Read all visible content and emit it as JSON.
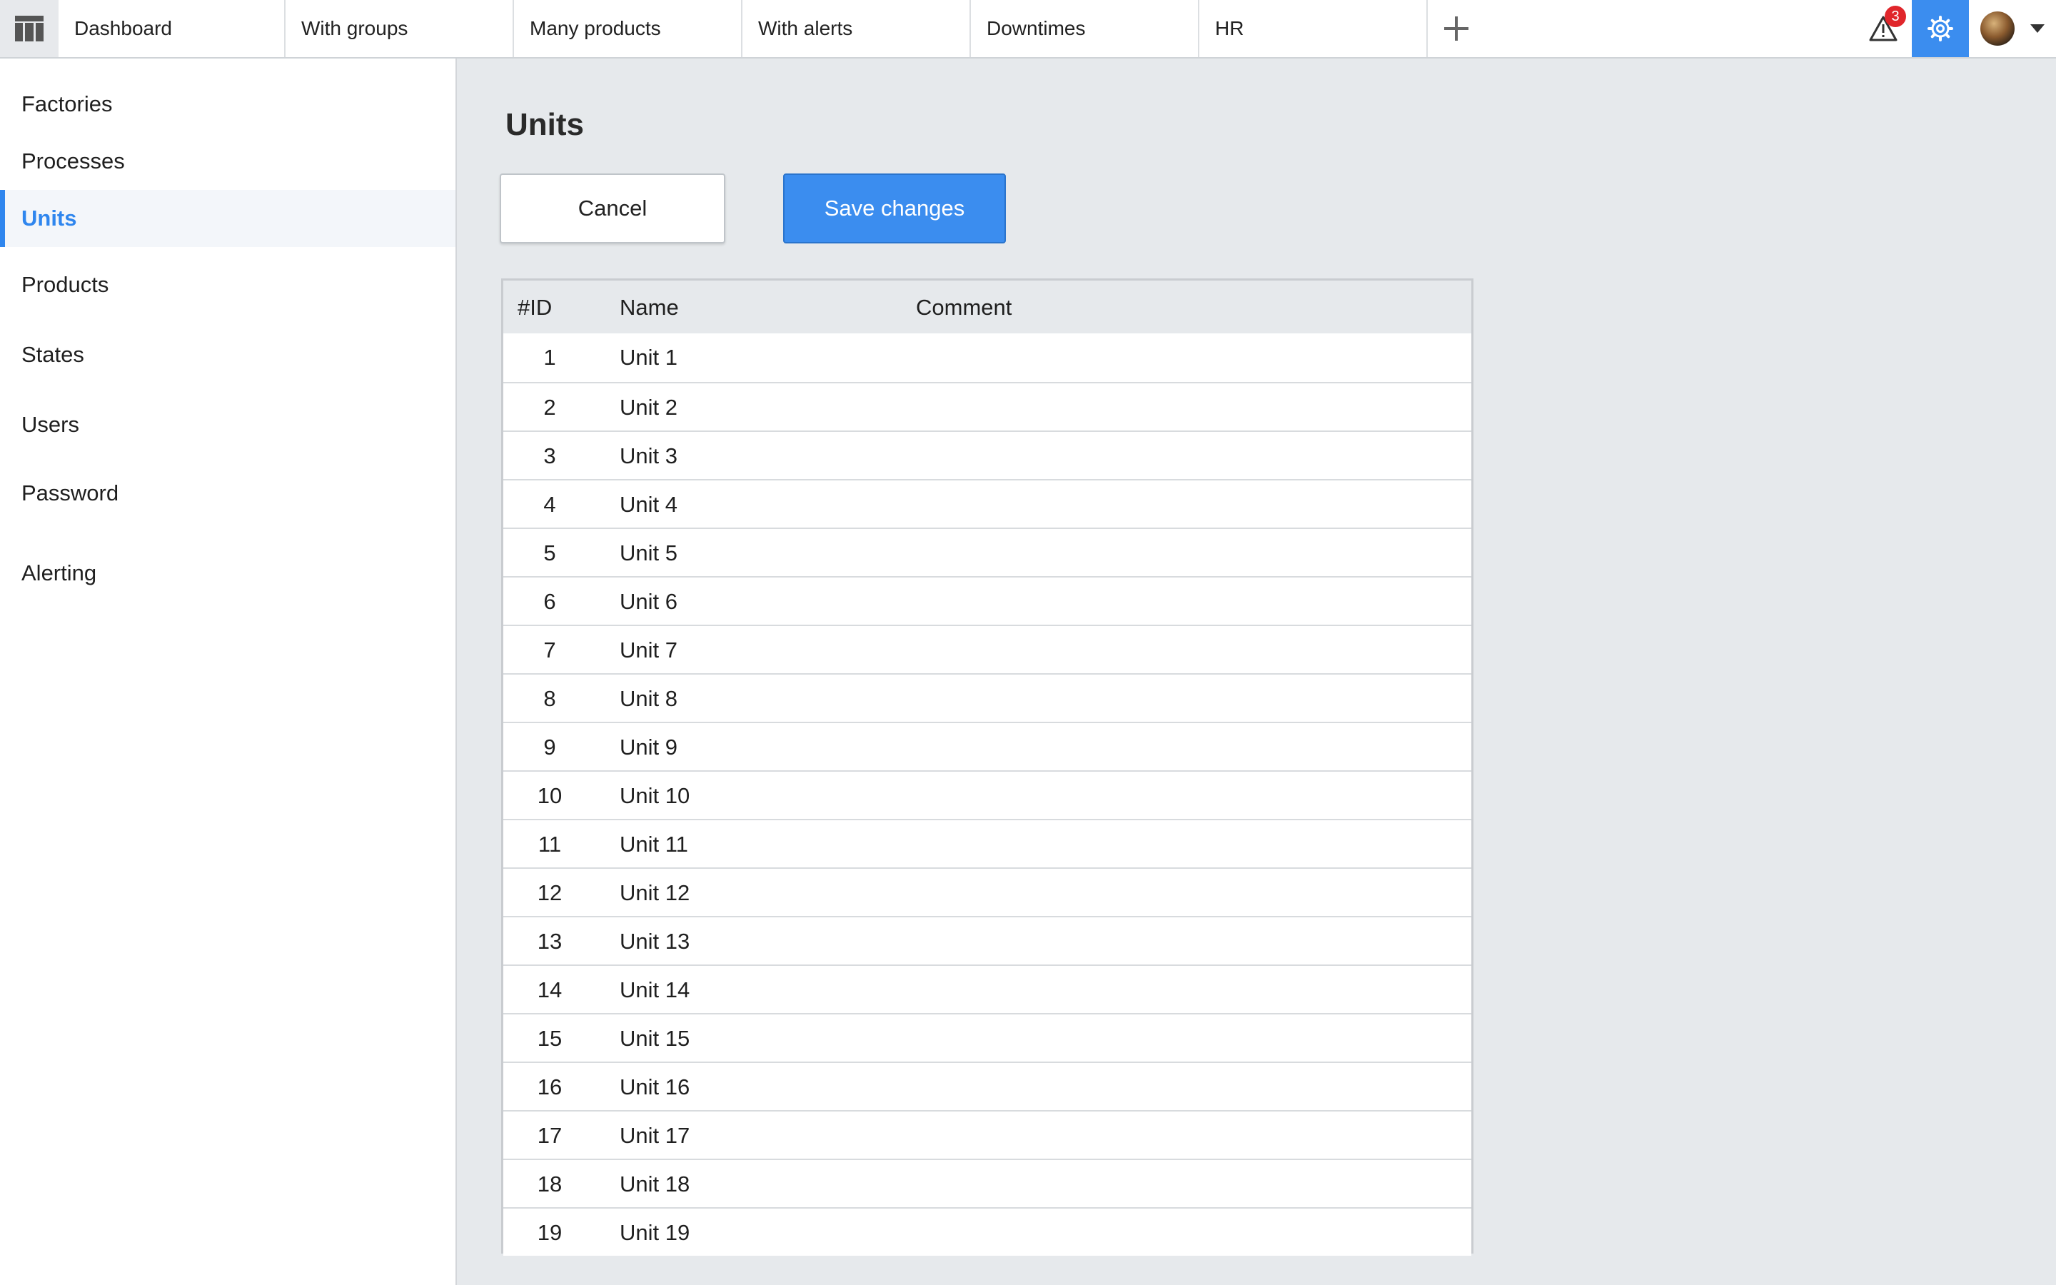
{
  "topbar": {
    "tabs": [
      "Dashboard",
      "With groups",
      "Many products",
      "With alerts",
      "Downtimes",
      "HR"
    ],
    "alert_count": "3",
    "icons": {
      "menu": "table-grid-icon",
      "add": "plus-icon",
      "alert": "warning-triangle-icon",
      "settings": "gear-icon",
      "user": "avatar",
      "dropdown": "caret-down-icon"
    },
    "accent_color": "#3b8def",
    "badge_color": "#e0262b"
  },
  "sidebar": {
    "items": [
      "Factories",
      "Processes",
      "Units",
      "Products",
      "States",
      "Users",
      "Password",
      "Alerting"
    ],
    "active": "Units"
  },
  "main": {
    "title": "Units",
    "cancel_label": "Cancel",
    "save_label": "Save changes"
  },
  "table": {
    "columns": [
      "#ID",
      "Name",
      "Comment"
    ],
    "rows": [
      {
        "id": "1",
        "name": "Unit 1",
        "comment": ""
      },
      {
        "id": "2",
        "name": "Unit 2",
        "comment": ""
      },
      {
        "id": "3",
        "name": "Unit 3",
        "comment": ""
      },
      {
        "id": "4",
        "name": "Unit 4",
        "comment": ""
      },
      {
        "id": "5",
        "name": "Unit 5",
        "comment": ""
      },
      {
        "id": "6",
        "name": "Unit 6",
        "comment": ""
      },
      {
        "id": "7",
        "name": "Unit 7",
        "comment": ""
      },
      {
        "id": "8",
        "name": "Unit 8",
        "comment": ""
      },
      {
        "id": "9",
        "name": "Unit 9",
        "comment": ""
      },
      {
        "id": "10",
        "name": "Unit 10",
        "comment": ""
      },
      {
        "id": "11",
        "name": "Unit 11",
        "comment": ""
      },
      {
        "id": "12",
        "name": "Unit 12",
        "comment": ""
      },
      {
        "id": "13",
        "name": "Unit 13",
        "comment": ""
      },
      {
        "id": "14",
        "name": "Unit 14",
        "comment": ""
      },
      {
        "id": "15",
        "name": "Unit 15",
        "comment": ""
      },
      {
        "id": "16",
        "name": "Unit 16",
        "comment": ""
      },
      {
        "id": "17",
        "name": "Unit 17",
        "comment": ""
      },
      {
        "id": "18",
        "name": "Unit 18",
        "comment": ""
      },
      {
        "id": "19",
        "name": "Unit 19",
        "comment": ""
      }
    ]
  }
}
